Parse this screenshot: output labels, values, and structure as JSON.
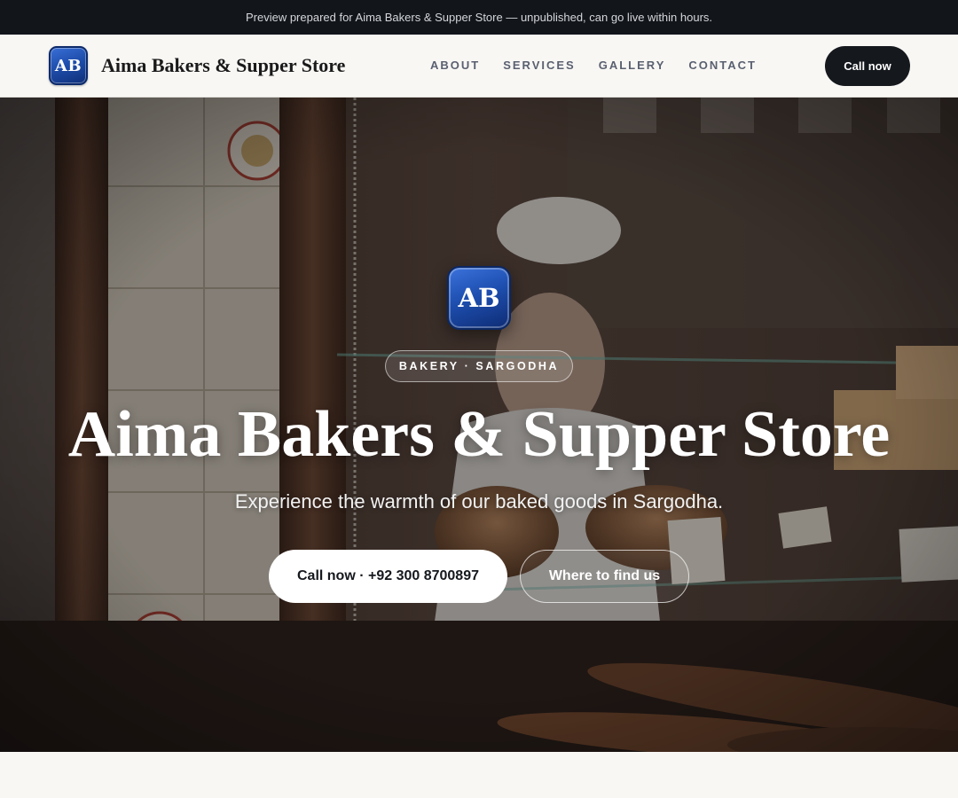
{
  "preview_bar": {
    "text": "Preview prepared for Aima Bakers & Supper Store — unpublished, can go live within hours."
  },
  "navbar": {
    "logo_initials": "AB",
    "brand_name": "Aima Bakers & Supper Store",
    "links": [
      {
        "label": "ABOUT"
      },
      {
        "label": "SERVICES"
      },
      {
        "label": "GALLERY"
      },
      {
        "label": "CONTACT"
      }
    ],
    "cta_label": "Call now"
  },
  "hero": {
    "logo_initials": "AB",
    "badge": "BAKERY · SARGODHA",
    "title": "Aima Bakers & Supper Store",
    "subtitle": "Experience the warmth of our baked goods in Sargodha.",
    "primary_button": "Call now · +92 300 8700897",
    "secondary_button": "Where to find us",
    "background_image": "bakery-window-photo"
  },
  "colors": {
    "preview_bar_bg": "#12151a",
    "page_bg": "#f8f7f4",
    "dark_button": "#15181d",
    "logo_blue": "#1f4fae",
    "nav_link": "#5a6070"
  }
}
